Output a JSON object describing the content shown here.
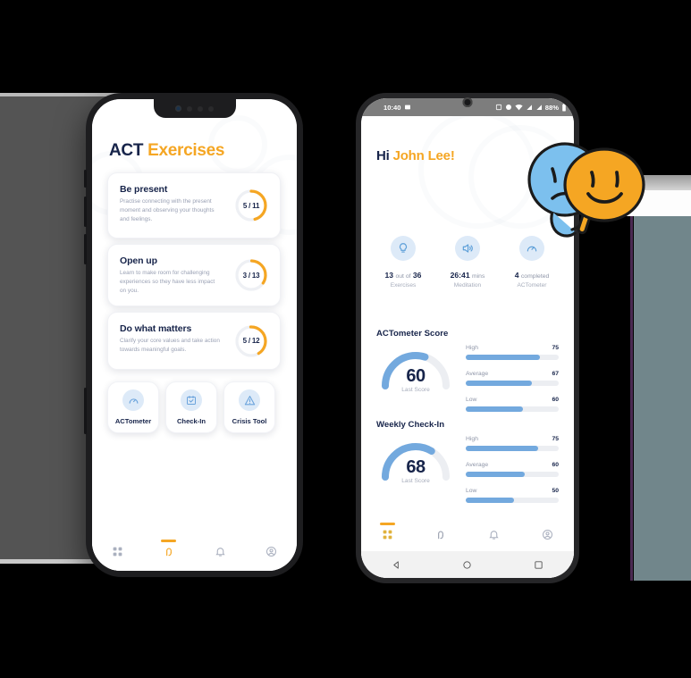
{
  "colors": {
    "navy": "#17244a",
    "orange": "#f5a623",
    "blue": "#73a9de",
    "muted": "#9aa1b4",
    "track": "#eceef2",
    "icon_bg": "#ddeaf8",
    "teal_panel": "#71868b",
    "gray_panel": "#545454"
  },
  "left_phone": {
    "title": {
      "part1": "ACT",
      "part2": "Exercises"
    },
    "exercises": [
      {
        "title": "Be present",
        "desc": "Practise connecting with the present moment and observing your thoughts and feelings.",
        "progress_label": "5 / 11",
        "done": 5,
        "total": 11
      },
      {
        "title": "Open up",
        "desc": "Learn to make room for challenging experiences so they have less impact on you.",
        "progress_label": "3 / 13",
        "done": 3,
        "total": 13
      },
      {
        "title": "Do what matters",
        "desc": "Clarify your core values and take action towards meaningful goals.",
        "progress_label": "5 / 12",
        "done": 5,
        "total": 12
      }
    ],
    "tiles": [
      {
        "label": "ACTometer",
        "icon": "gauge-icon"
      },
      {
        "label": "Check-In",
        "icon": "calendar-check-icon"
      },
      {
        "label": "Crisis Tool",
        "icon": "warning-triangle-icon"
      }
    ],
    "tabs": [
      {
        "name": "dashboard",
        "icon": "grid-icon",
        "active": false
      },
      {
        "name": "exercises",
        "icon": "hand-heart-icon",
        "active": true
      },
      {
        "name": "notifications",
        "icon": "bell-icon",
        "active": false
      },
      {
        "name": "profile",
        "icon": "user-circle-icon",
        "active": false
      }
    ]
  },
  "right_phone": {
    "status_bar": {
      "time": "10:40",
      "left_icons": [
        "image-icon"
      ],
      "right_icons": [
        "nfc-icon",
        "bluetooth-icon",
        "wifi-icon",
        "signal-icon",
        "signal-2-icon"
      ],
      "battery": "88%"
    },
    "greeting": {
      "prefix": "Hi",
      "name": "John Lee!"
    },
    "stats": [
      {
        "icon": "lightbulb-icon",
        "value": "13",
        "unit": "out of",
        "value2": "36",
        "caption": "Exercises"
      },
      {
        "icon": "speaker-icon",
        "value": "26:41",
        "unit": "mins",
        "value2": "",
        "caption": "Meditation"
      },
      {
        "icon": "gauge-icon",
        "value": "4",
        "unit": "completed",
        "value2": "",
        "caption": "ACTometer"
      }
    ],
    "sections": [
      {
        "title": "ACTometer Score",
        "gauge": {
          "value": "60",
          "caption": "Last Score",
          "percent": 60
        },
        "bars": [
          {
            "label": "High",
            "value": "75"
          },
          {
            "label": "Average",
            "value": "67"
          },
          {
            "label": "Low",
            "value": "60"
          }
        ]
      },
      {
        "title": "Weekly Check-In",
        "gauge": {
          "value": "68",
          "caption": "Last Score",
          "percent": 68
        },
        "bars": [
          {
            "label": "High",
            "value": "75"
          },
          {
            "label": "Average",
            "value": "60"
          },
          {
            "label": "Low",
            "value": "50"
          }
        ]
      }
    ],
    "tabs": [
      {
        "name": "dashboard",
        "icon": "grid-icon",
        "active": true
      },
      {
        "name": "exercises",
        "icon": "hand-heart-icon",
        "active": false
      },
      {
        "name": "notifications",
        "icon": "bell-icon",
        "active": false
      },
      {
        "name": "profile",
        "icon": "user-circle-icon",
        "active": false
      }
    ],
    "android_nav": [
      "back-icon",
      "home-icon",
      "recents-icon"
    ]
  },
  "mascot": {
    "alt": "blue-sad-face-holding-orange-smiley-mask"
  }
}
